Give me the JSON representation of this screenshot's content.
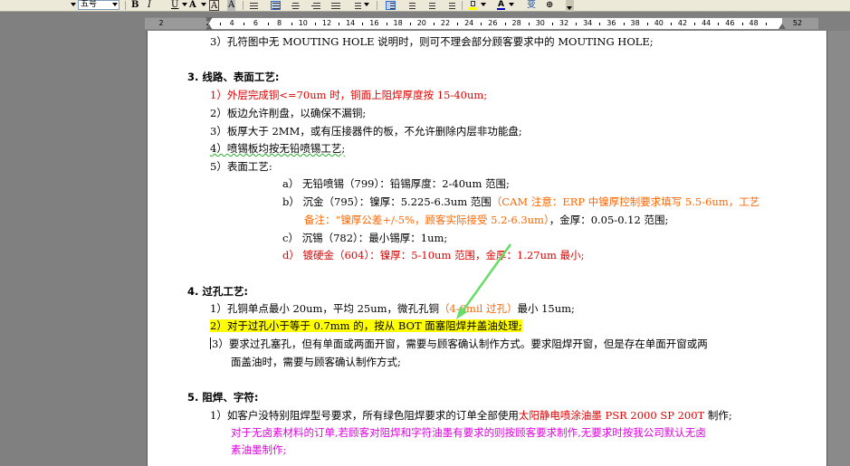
{
  "toolbar": {
    "font_size_value": "五号",
    "bold_label": "B",
    "italic_label": "I",
    "underline_label": "U",
    "char_scale_label": "A",
    "char_border_label": "A",
    "char_shade_label": "A",
    "highlight_color": "#ffff00",
    "font_color": "#0000cc",
    "phonetic_label": "变",
    "enclose_label": "⊕"
  },
  "ruler": {
    "left_marker": "2",
    "numbers": [
      "2",
      "4",
      "6",
      "8",
      "10",
      "12",
      "14",
      "16",
      "18",
      "20",
      "22",
      "24",
      "26",
      "28",
      "30",
      "32",
      "34",
      "36",
      "38",
      "40",
      "42",
      "44",
      "46",
      "48",
      "52"
    ]
  },
  "document": {
    "line_top": "3）孔符图中无 MOUTING HOLE 说明时，则可不理会部分顾客要求中的 MOUTING HOLE;",
    "s3_title": "3.  线路、表面工艺:",
    "s3_1": "1）外层完成铜<=70um 时，铜面上阻焊厚度按 15-40um;",
    "s3_2": "2）板边允许削盘，以确保不漏铜;",
    "s3_3": "3）板厚大于 2MM，或有压接器件的板，不允许删除内层非功能盘;",
    "s3_4": "4）喷锡板均按无铅喷锡工艺;",
    "s3_5": "5）表面工艺:",
    "s3_5a": "a） 无铅喷锡（799）：铅锡厚度：2-40um 范围;",
    "s3_5b_black": "b） 沉金（795）：镍厚：5.225-6.3um 范围",
    "s3_5b_orange": "（CAM 注意：ERP 中镍厚控制要求填写 5.5-6um，工艺",
    "s3_5b2_orange": "备注：“镍厚公差+/-5%，顾客实际接受 5.2-6.3um）",
    "s3_5b2_black": "，金厚：0.05-0.12 范围;",
    "s3_5c": "c） 沉锡（782）：最小锡厚：1um;",
    "s3_5d": "d） 镀硬金（604）：镍厚：5-10um 范围，金厚：1.27um 最小;",
    "s4_title": "4.  过孔工艺:",
    "s4_1_black": "1）孔铜单点最小 20um，平均 25um，微孔孔铜",
    "s4_1_orange": "（4-6mil 过孔）",
    "s4_1_black2": "最小 15um;",
    "s4_2": "2）对于过孔小于等于 0.7mm 的，按从 BOT 面塞阻焊并盖油处理;",
    "s4_3a": "3）要求过孔塞孔，但有单面或两面开窗，需要与顾客确认制作方式。要求阻焊开窗，但是存在单面开窗或两",
    "s4_3b": "面盖油时，需要与顾客确认制作方式;",
    "s5_title": "5.  阻焊、字符:",
    "s5_1_black": "1）如客户没特别阻焊型号要求，所有绿色阻焊要求的订单全部使用",
    "s5_1_red": "太阳静电喷涂油墨 PSR 2000 SP 200T",
    "s5_1_black2": " 制作;",
    "s5_1b": "对于无卤素材料的订单,若顾客对阻焊和字符油墨有要求的则按顾客要求制作,无要求时按我公司默认无卤",
    "s5_1c": "素油墨制作;"
  },
  "colors": {
    "accent_red": "#e00000",
    "accent_orange": "#ff6600",
    "accent_magenta": "#e000e0",
    "highlight": "#ffff00",
    "arrow_green": "#66dd66"
  }
}
